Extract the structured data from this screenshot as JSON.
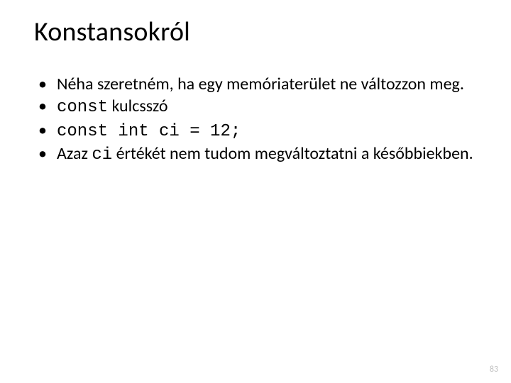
{
  "title": "Konstansokról",
  "bullets": {
    "b1": "Néha szeretném, ha egy memóriaterület ne változzon meg.",
    "b2_code": "const",
    "b2_rest": " kulcsszó",
    "b3_code": "const int ci = 12;",
    "b4_pre": "Azaz ",
    "b4_code": "ci",
    "b4_post": " értékét nem tudom megváltoztatni a későbbiekben."
  },
  "page_number": "83"
}
